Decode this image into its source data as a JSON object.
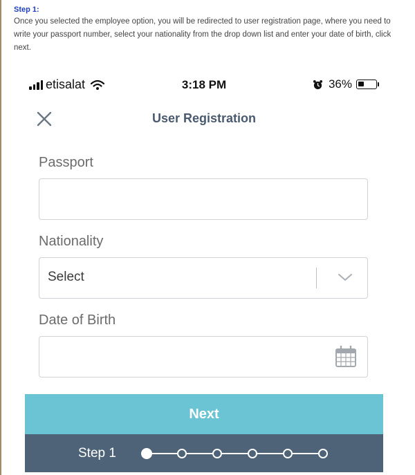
{
  "instructions": {
    "title": "Step 1:",
    "text": "Once you selected the employee option, you will be redirected to user registration page, where you need to write your passport number, select your nationality from the drop down list and enter your date of birth, click next."
  },
  "statusbar": {
    "carrier": "etisalat",
    "time": "3:18 PM",
    "battery": "36%",
    "battery_level": 0.36
  },
  "header": {
    "title": "User Registration",
    "close_icon": "close-icon"
  },
  "form": {
    "passport": {
      "label": "Passport",
      "value": "",
      "placeholder": ""
    },
    "nationality": {
      "label": "Nationality",
      "selected": "Select"
    },
    "dob": {
      "label": "Date of Birth",
      "value": "",
      "placeholder": ""
    }
  },
  "next_label": "Next",
  "stepper": {
    "label": "Step 1",
    "total_steps": 6,
    "current_step": 1
  },
  "colors": {
    "accent": "#6ac4d4",
    "stepper_bg": "#4e6377",
    "title": "#4a5a6e",
    "instruction_title": "#1f3fbf"
  }
}
